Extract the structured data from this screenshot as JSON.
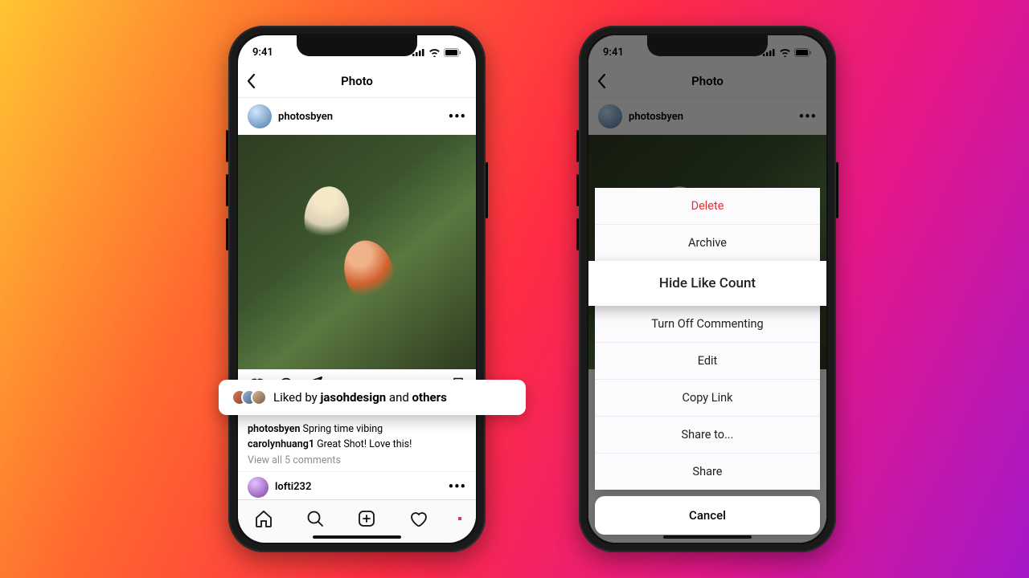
{
  "status": {
    "time": "9:41"
  },
  "nav": {
    "title": "Photo"
  },
  "post": {
    "username": "photosbyen",
    "liked_by_prefix": "Liked by ",
    "liked_by_user": "jasohdesign",
    "liked_by_middle": " and ",
    "liked_by_suffix": "others",
    "caption_user": "photosbyen",
    "caption_text": " Spring time vibing",
    "comment_user": "carolynhuang1",
    "comment_text": " Great Shot! Love this!",
    "view_all": "View all 5 comments"
  },
  "next_post": {
    "username": "lofti232"
  },
  "sheet": {
    "items": [
      {
        "label": "Delete",
        "kind": "destructive"
      },
      {
        "label": "Archive",
        "kind": "normal"
      },
      {
        "label": "Hide Like Count",
        "kind": "highlight"
      },
      {
        "label": "Turn Off Commenting",
        "kind": "normal"
      },
      {
        "label": "Edit",
        "kind": "normal"
      },
      {
        "label": "Copy Link",
        "kind": "normal"
      },
      {
        "label": "Share to...",
        "kind": "normal"
      },
      {
        "label": "Share",
        "kind": "normal"
      }
    ],
    "cancel": "Cancel"
  }
}
